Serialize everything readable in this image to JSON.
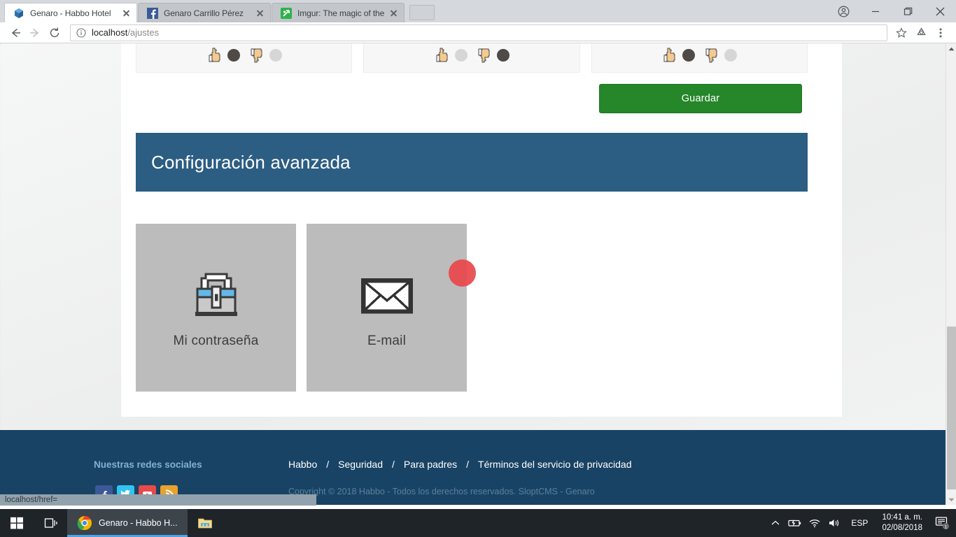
{
  "browser": {
    "tabs": [
      {
        "title": "Genaro - Habbo Hotel",
        "favicon": "habbo-icon",
        "active": true
      },
      {
        "title": "Genaro Carrillo Pérez",
        "favicon": "facebook-icon",
        "active": false
      },
      {
        "title": "Imgur: The magic of the I",
        "favicon": "imgur-icon",
        "active": false
      }
    ],
    "window_controls": {
      "profile": "account-icon",
      "minimize": "minimize-icon",
      "maximize": "maximize-icon",
      "close": "close-icon"
    },
    "nav": {
      "back": "back-arrow-icon",
      "forward": "forward-arrow-icon",
      "reload": "reload-icon"
    },
    "address": {
      "info_icon": "page-info-icon",
      "host": "localhost",
      "path": "/ajustes",
      "bookmark": "star-icon",
      "extension": "recycle-icon",
      "menu": "three-dot-menu-icon"
    },
    "status_tooltip": "localhost/href="
  },
  "page": {
    "ratings": [
      {
        "up_selected": true,
        "down_selected": false
      },
      {
        "up_selected": false,
        "down_selected": true
      },
      {
        "up_selected": true,
        "down_selected": false
      }
    ],
    "save_button": "Guardar",
    "section_title": "Configuración avanzada",
    "tiles": [
      {
        "label": "Mi contraseña",
        "icon": "padlock-icon"
      },
      {
        "label": "E-mail",
        "icon": "envelope-icon"
      }
    ],
    "footer": {
      "social_title": "Nuestras redes sociales",
      "socials": [
        {
          "name": "facebook-icon",
          "color": "#3b5998"
        },
        {
          "name": "twitter-icon",
          "color": "#31c4f3"
        },
        {
          "name": "youtube-icon",
          "color": "#e8494b"
        },
        {
          "name": "rss-icon",
          "color": "#e8a22e"
        }
      ],
      "links": [
        "Habbo",
        "Seguridad",
        "Para padres",
        "Términos del servicio de privacidad"
      ],
      "separator": "/",
      "copyright": "Copyright © 2018 Habbo - Todos los derechos reservados. SloptCMS - Genaro"
    },
    "colors": {
      "header_blue": "#2c5d82",
      "footer_blue": "#194364",
      "save_green": "#25862a",
      "tile_gray": "#bcbcbc",
      "cursor_red": "#e8474b"
    }
  },
  "taskbar": {
    "start": "windows-start-icon",
    "task_view": "task-view-icon",
    "apps": [
      {
        "label": "Genaro - Habbo H...",
        "icon": "chrome-icon",
        "active": true
      },
      {
        "label": "",
        "icon": "file-explorer-icon",
        "active": false
      }
    ],
    "tray": {
      "chevron": "show-hidden-icons-icon",
      "battery": "battery-icon",
      "wifi": "wifi-icon",
      "volume": "volume-icon",
      "language": "ESP",
      "time": "10:41 a. m.",
      "date": "02/08/2018",
      "notifications_icon": "action-center-icon",
      "notifications_count": "1"
    }
  }
}
